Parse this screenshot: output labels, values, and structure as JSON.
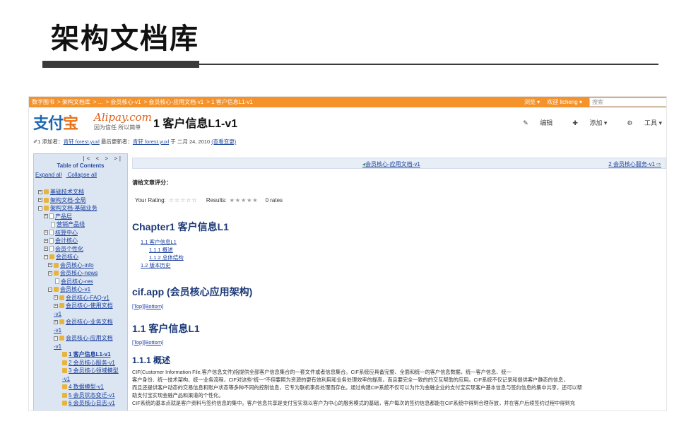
{
  "slide": {
    "title": "架构文档库"
  },
  "topbar": {
    "crumbs": [
      "数字图书",
      "架构文档库",
      "...",
      "会员核心-v1",
      "会员核心-应用文档-v1",
      "1 客户信息L1-v1"
    ],
    "browse": "浏览 ▾",
    "user": "欢迎 llcheng ▾",
    "search_placeholder": "搜索"
  },
  "logo": {
    "cn_a": "支付",
    "cn_b": "宝",
    "en": "Alipay.com",
    "slogan": "因为信任  所以简单"
  },
  "page": {
    "heading": "1 客户信息L1-v1",
    "edit": "编辑",
    "add": "添加 ▾",
    "tools": "工具 ▾",
    "meta_prefix": "1 添加者：",
    "meta_author": "青轩 forest.yuxl",
    "meta_mid": "最后更新者：",
    "meta_editor": "青轩 forest.yuxl",
    "meta_date": "于 二月 24, 2010",
    "meta_changes": "(查看变更)"
  },
  "sidebar": {
    "nav_arrows": "|< < > >|",
    "heading": "Table of Contents",
    "expand_all": "Expand all",
    "collapse_all": "Collapse all",
    "items": [
      {
        "label": "基础技术文档"
      },
      {
        "label": "架构文档-全局"
      },
      {
        "label": "架构文档-基础业务"
      },
      {
        "label": "产品层"
      },
      {
        "label": "营销产品线"
      },
      {
        "label": "核算中心"
      },
      {
        "label": "会计核心"
      },
      {
        "label": "会员个性化"
      },
      {
        "label": "会员核心"
      },
      {
        "label": "会员核心-info"
      },
      {
        "label": "会员核心-news"
      },
      {
        "label": "会员核心-res"
      },
      {
        "label": "会员核心-v1"
      },
      {
        "label": "会员核心-FAQ-v1"
      },
      {
        "label": "会员核心-使用文档"
      },
      {
        "label": "-v1"
      },
      {
        "label": "会员核心-业务文档"
      },
      {
        "label": "-v1"
      },
      {
        "label": "会员核心-应用文档"
      },
      {
        "label": "-v1"
      },
      {
        "label": "1 客户信息L1-v1"
      },
      {
        "label": "2 会员核心服务-v1"
      },
      {
        "label": "3 会员核心领域模型"
      },
      {
        "label": "-v1"
      },
      {
        "label": "4 数据模型-v1"
      },
      {
        "label": "5 会员状态变迁-v1"
      },
      {
        "label": "6 会员核心日志-v1"
      }
    ]
  },
  "content": {
    "nav_prev": "会员核心-应用文档-v1",
    "nav_next": "2 会员核心服务-v1",
    "rate_label": "请给文章评分：",
    "your_rating": "Your Rating:",
    "results": "Results:",
    "rates": "0 rates",
    "chapter_title": "Chapter1 客户信息L1",
    "toc": [
      "1.1 客户信息L1",
      "1.1.1 概述",
      "1.1.2 总体结构",
      "1.2 版本历史"
    ],
    "app_title": "cif.app (会员核心应用架构)",
    "topbottom": "[Top][Bottom]",
    "sec11_title": "1.1 客户信息L1",
    "sec111_title": "1.1.1 概述",
    "para_lines": [
      "CIF(Customer Information File,客户信息文件)指提供全部客户信息集合的一套文件或者信息集合。CIF系统应具备完整、全面和统一的客户信息数据，统一客户信息、统一",
      "客户身份、统一技术架构、统一业务流程，CIF对这些“统一”不但要照为资源的更有效利用和业务处理效率的提高，而且要完全一致的的交互帮助的应用。CIF系统不仅记录和提供客户静态的信息，",
      "而且还提供客户动态的交易信息和账户状态等多种不同的控制信息，它专为联机事务处理而存在。通过构建CIF系统不仅可以为作为金融企业的支付宝实现客户基本信息与签约信息的集中共享，还可以帮",
      "助支付宝实现金融产品和渠道的个性化。",
      "CIF系统的基本点就是客户资料与签约信息的集中。客户信息共享是支付宝实现以客户为中心的服务模式的基础，客户每次的签约信息都能在CIF系统中得到合理存放，并在客户后续签约过程中得到充"
    ]
  }
}
